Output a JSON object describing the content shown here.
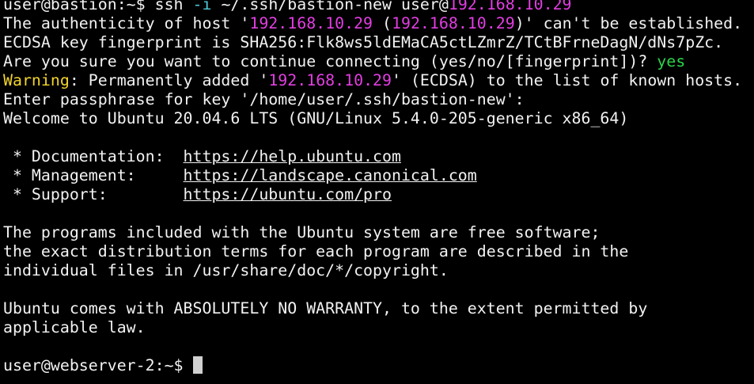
{
  "colors": {
    "background": "#000000",
    "foreground": "#f2f2f2",
    "host": "#e23ee2",
    "option": "#4ec9d8",
    "answer": "#2dd44b",
    "warning": "#f2d42b"
  },
  "command": {
    "prompt": "user@bastion:~$ ",
    "cmd": "ssh ",
    "flag": "-i",
    "args": " ~/.ssh/bastion-new user@",
    "host": "192.168.10.29"
  },
  "auth": {
    "text1": "The authenticity of host '",
    "host1": "192.168.10.29",
    "text2": " (",
    "host2": "192.168.10.29",
    "text3": ")' can't be established.",
    "fingerprint": "ECDSA key fingerprint is SHA256:Flk8ws5ldEMaCA5ctLZmrZ/TCtBFrneDagN/dNs7pZc.",
    "question": "Are you sure you want to continue connecting (yes/no/[fingerprint])? ",
    "answer": "yes"
  },
  "warning": {
    "label": "Warning",
    "text1": ": Permanently added '",
    "host": "192.168.10.29",
    "text2": "' (ECDSA) to the list of known hosts."
  },
  "passphrase": "Enter passphrase for key '/home/user/.ssh/bastion-new':",
  "welcome": "Welcome to Ubuntu 20.04.6 LTS (GNU/Linux 5.4.0-205-generic x86_64)",
  "links": [
    {
      "label": " * Documentation:  ",
      "url": "https://help.ubuntu.com"
    },
    {
      "label": " * Management:     ",
      "url": "https://landscape.canonical.com"
    },
    {
      "label": " * Support:        ",
      "url": "https://ubuntu.com/pro"
    }
  ],
  "notice": [
    "The programs included with the Ubuntu system are free software;",
    "the exact distribution terms for each program are described in the",
    "individual files in /usr/share/doc/*/copyright."
  ],
  "warranty": [
    "Ubuntu comes with ABSOLUTELY NO WARRANTY, to the extent permitted by",
    "applicable law."
  ],
  "final_prompt": "user@webserver-2:~$ "
}
